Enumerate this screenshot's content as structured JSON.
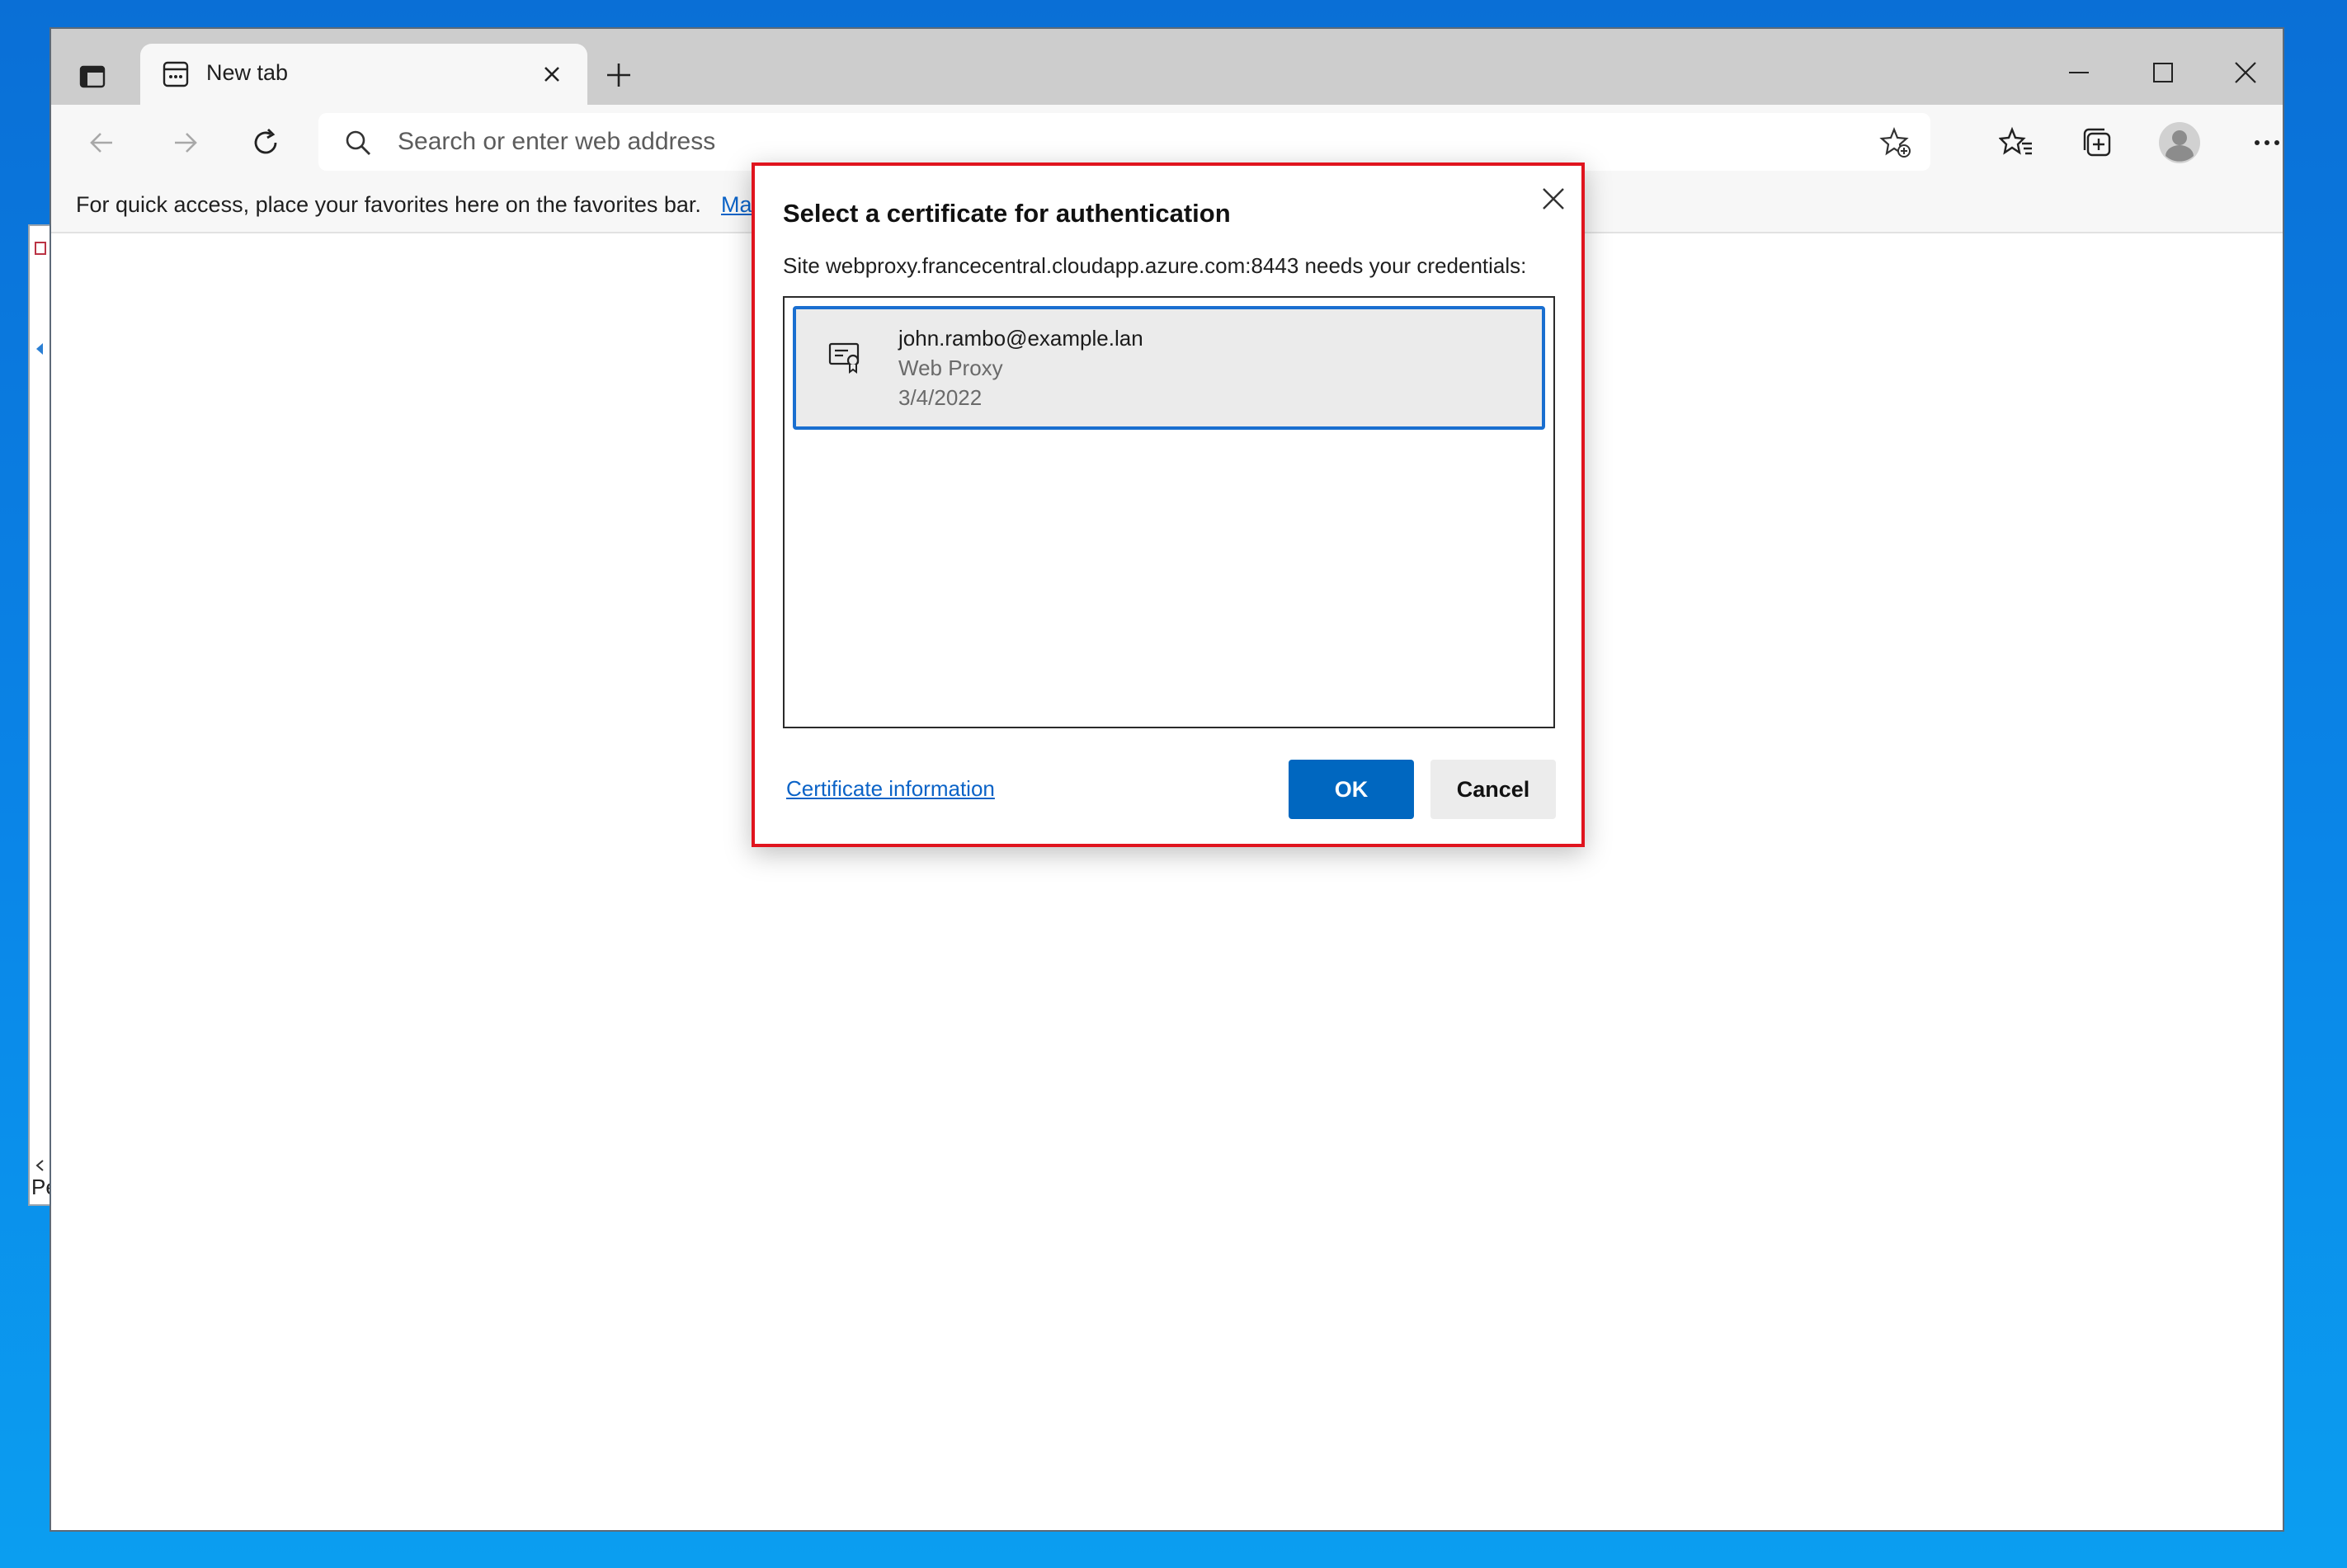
{
  "browser": {
    "tab": {
      "title": "New tab"
    },
    "addressbar": {
      "placeholder": "Search or enter web address"
    },
    "favorites_bar": {
      "hint": "For quick access, place your favorites here on the favorites bar.",
      "link_text": "Ma"
    }
  },
  "background_window": {
    "partial_text": "Pe"
  },
  "dialog": {
    "title": "Select a certificate for authentication",
    "subtitle": "Site webproxy.francecentral.cloudapp.azure.com:8443 needs your credentials:",
    "certificates": [
      {
        "name": "john.rambo@example.lan",
        "issuer": "Web Proxy",
        "date": "3/4/2022"
      }
    ],
    "cert_info_link": "Certificate information",
    "ok_label": "OK",
    "cancel_label": "Cancel"
  },
  "colors": {
    "desktop": "#0a86e8",
    "accent": "#0067c0",
    "highlight_border": "#e0141e",
    "selection_border": "#1a6fd0"
  },
  "icons": [
    "tab-actions-icon",
    "new-tab-page-icon",
    "close-icon",
    "plus-icon",
    "minimize-icon",
    "maximize-icon",
    "back-arrow-icon",
    "forward-arrow-icon",
    "refresh-icon",
    "search-icon",
    "add-favorite-icon",
    "favorites-icon",
    "collections-icon",
    "profile-avatar-icon",
    "more-options-icon",
    "certificate-icon"
  ]
}
